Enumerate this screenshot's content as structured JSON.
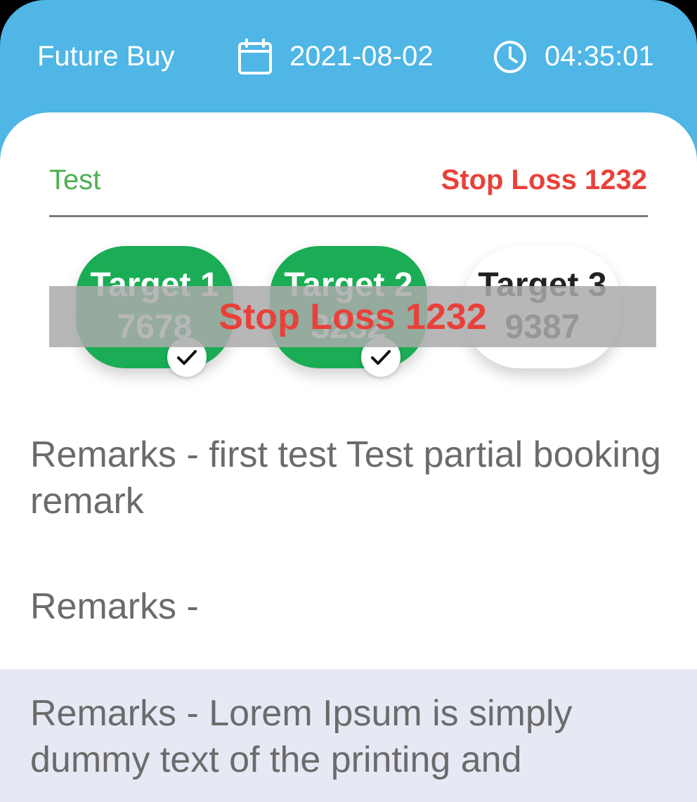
{
  "header": {
    "trade_type": "Future  Buy",
    "date": "2021-08-02",
    "time": "04:35:01",
    "date_icon": "calendar-icon",
    "time_icon": "clock-icon",
    "background_color": "#4fb6e5"
  },
  "card": {
    "name": "Test",
    "stop_loss_label": "Stop Loss  1232",
    "targets": [
      {
        "label": "Target 1",
        "value": "7678",
        "achieved": true
      },
      {
        "label": "Target 2",
        "value": "3232",
        "achieved": true
      },
      {
        "label": "Target 3",
        "value": "9387",
        "achieved": false
      }
    ],
    "overlay_text": "Stop Loss  1232",
    "remarks": [
      "Remarks - first test Test partial booking remark",
      "Remarks -",
      "Remarks - Lorem Ipsum is simply dummy text of the printing and"
    ],
    "colors": {
      "achieved": "#1aad55",
      "stop_loss": "#e8413a",
      "name": "#4caf50"
    }
  }
}
